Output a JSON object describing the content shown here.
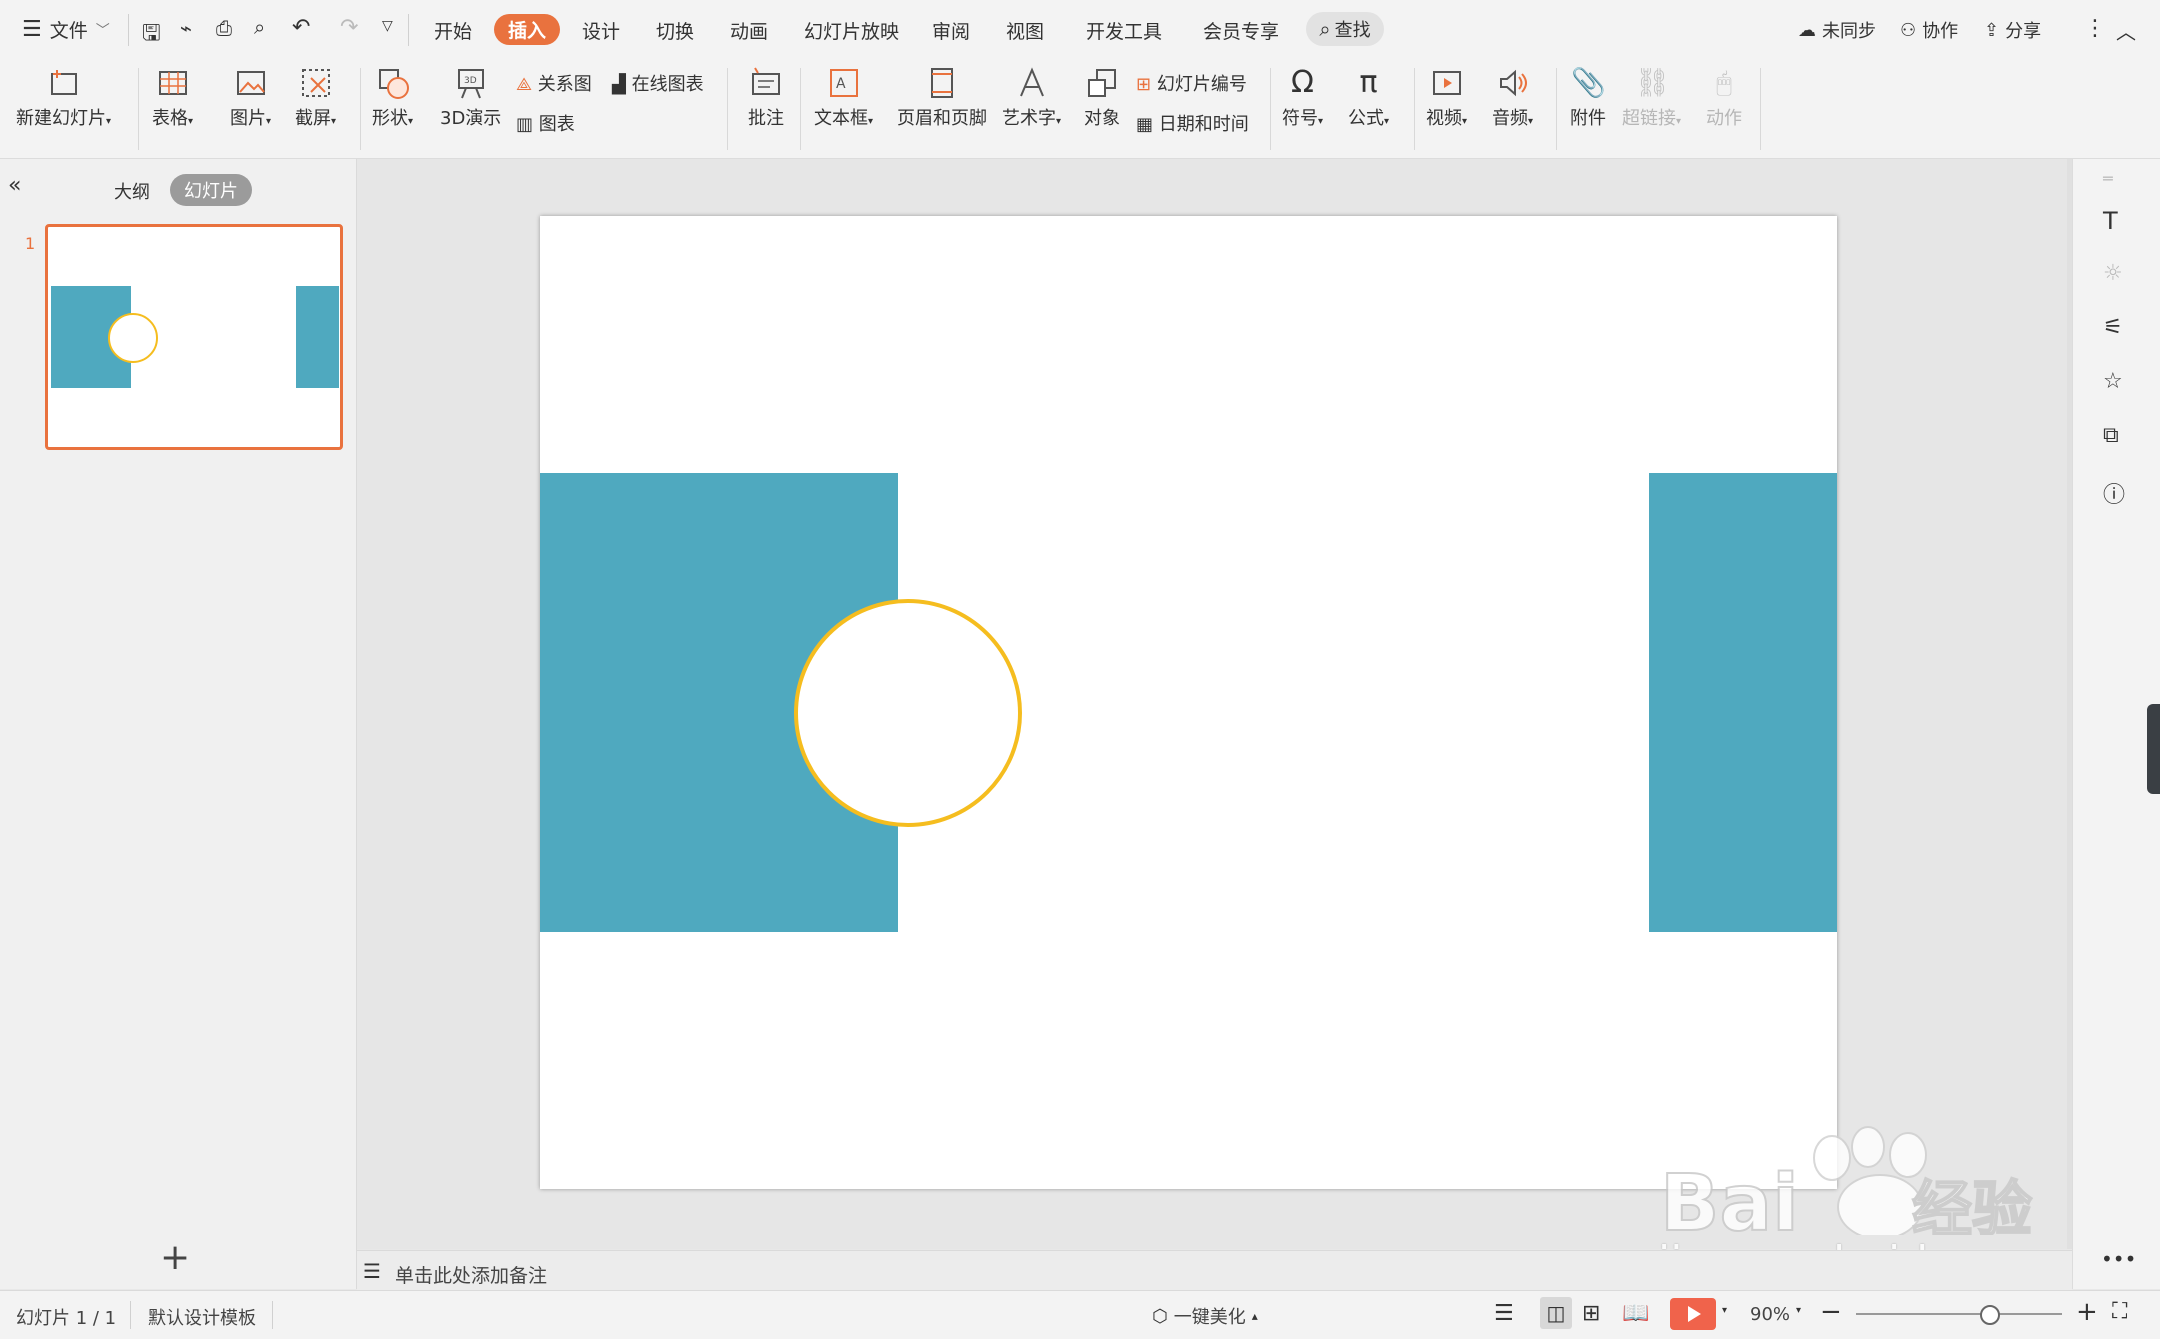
{
  "topbar": {
    "file_label": "文件",
    "menus": [
      "开始",
      "插入",
      "设计",
      "切换",
      "动画",
      "幻灯片放映",
      "审阅",
      "视图",
      "开发工具",
      "会员专享"
    ],
    "active_menu": "插入",
    "search_label": "查找",
    "sync_label": "未同步",
    "collab_label": "协作",
    "share_label": "分享"
  },
  "ribbon": {
    "new_slide": "新建幻灯片",
    "table": "表格",
    "picture": "图片",
    "screenshot": "截屏",
    "shape": "形状",
    "demo3d": "3D演示",
    "relation": "关系图",
    "online_chart": "在线图表",
    "chart": "图表",
    "comment": "批注",
    "textbox": "文本框",
    "header_footer": "页眉和页脚",
    "wordart": "艺术字",
    "object": "对象",
    "slide_number": "幻灯片编号",
    "datetime": "日期和时间",
    "symbol": "符号",
    "formula": "公式",
    "video": "视频",
    "audio": "音频",
    "attachment": "附件",
    "hyperlink": "超链接",
    "action": "动作"
  },
  "leftpanel": {
    "tab_outline": "大纲",
    "tab_slides": "幻灯片",
    "slide_number": "1"
  },
  "notes": {
    "placeholder": "单击此处添加备注"
  },
  "statusbar": {
    "slide_info": "幻灯片 1 / 1",
    "template": "默认设计模板",
    "beautify": "一键美化",
    "zoom": "90%",
    "zoom_level": 0.64
  },
  "watermark": {
    "brand": "Baidu经验",
    "url": "jingyan.baidu.com"
  },
  "colors": {
    "accent": "#e9723e",
    "teal": "#4fa9bf",
    "circle_border": "#f5bd1f",
    "play": "#f0634b"
  }
}
